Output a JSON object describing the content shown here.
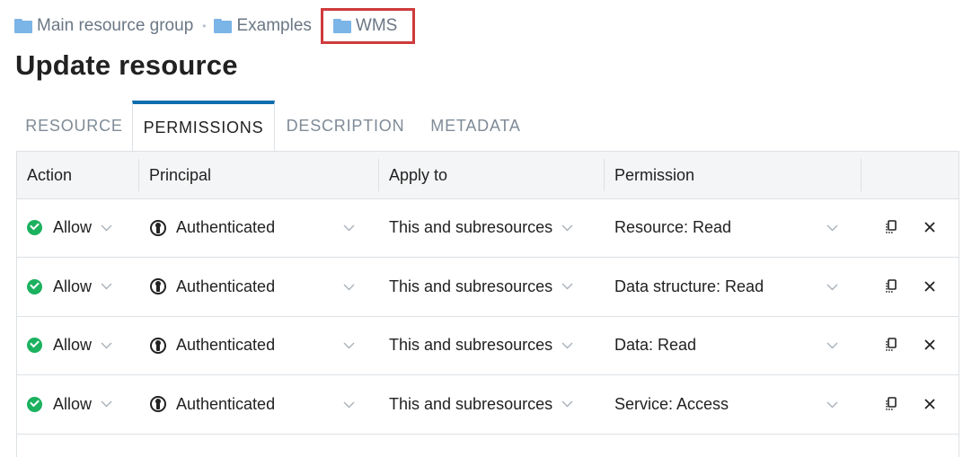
{
  "breadcrumb": {
    "items": [
      {
        "label": "Main resource group",
        "icon": "folder-icon"
      },
      {
        "label": "Examples",
        "icon": "folder-icon"
      },
      {
        "label": "WMS",
        "icon": "folder-icon"
      }
    ],
    "separator": "•"
  },
  "page": {
    "title": "Update resource"
  },
  "tabs": [
    {
      "label": "RESOURCE",
      "active": false
    },
    {
      "label": "PERMISSIONS",
      "active": true
    },
    {
      "label": "DESCRIPTION",
      "active": false
    },
    {
      "label": "METADATA",
      "active": false
    }
  ],
  "table": {
    "headers": [
      "Action",
      "Principal",
      "Apply to",
      "Permission"
    ],
    "rows": [
      {
        "action": "Allow",
        "principal": "Authenticated",
        "apply_to": "This and subresources",
        "permission": "Resource: Read"
      },
      {
        "action": "Allow",
        "principal": "Authenticated",
        "apply_to": "This and subresources",
        "permission": "Data structure: Read"
      },
      {
        "action": "Allow",
        "principal": "Authenticated",
        "apply_to": "This and subresources",
        "permission": "Data: Read"
      },
      {
        "action": "Allow",
        "principal": "Authenticated",
        "apply_to": "This and subresources",
        "permission": "Service: Access"
      }
    ]
  },
  "colors": {
    "accent": "#0f6dad",
    "allow": "#1bb15f",
    "highlight": "#cf3b3b",
    "folder": "#7bb4e6"
  }
}
